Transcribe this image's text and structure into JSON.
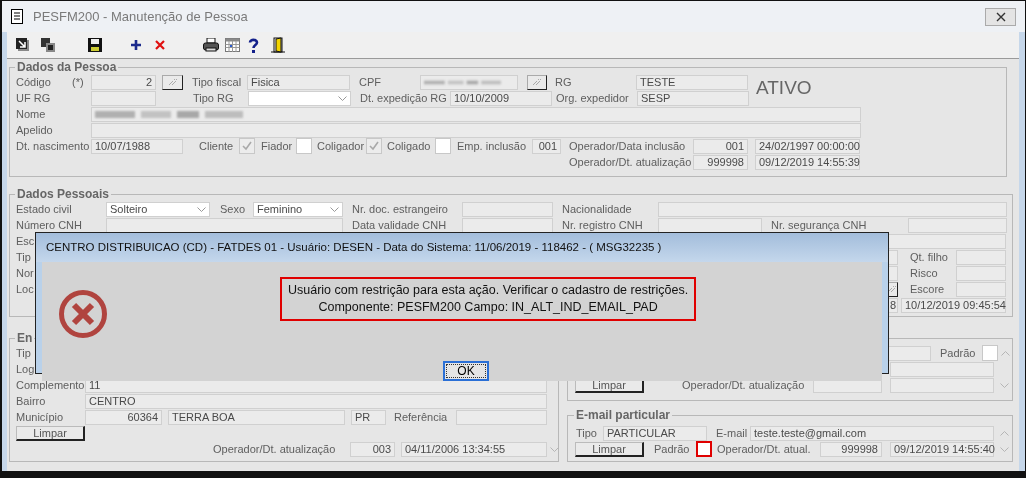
{
  "window": {
    "title": "PESFM200 - Manutenção de Pessoa"
  },
  "dados_pessoa": {
    "title": "Dados da Pessoa",
    "codigo": {
      "label": "Código",
      "required_mark": "(*)",
      "value": "2"
    },
    "tipo_fiscal": {
      "label": "Tipo fiscal",
      "value": "Fisica"
    },
    "cpf": {
      "label": "CPF"
    },
    "rg": {
      "label": "RG",
      "value": "TESTE"
    },
    "status": "ATIVO",
    "uf_rg": {
      "label": "UF RG"
    },
    "tipo_rg": {
      "label": "Tipo RG"
    },
    "dt_expedicao_rg": {
      "label": "Dt. expedição RG",
      "value": "10/10/2009"
    },
    "org_expedidor": {
      "label": "Org. expedidor",
      "value": "SESP"
    },
    "nome": {
      "label": "Nome"
    },
    "apelido": {
      "label": "Apelido"
    },
    "dt_nascimento": {
      "label": "Dt. nascimento",
      "value": "10/07/1988"
    },
    "flags": [
      {
        "label": "Cliente",
        "checked": true
      },
      {
        "label": "Fiador",
        "checked": false
      },
      {
        "label": "Coligador",
        "checked": true
      },
      {
        "label": "Coligado",
        "checked": false
      }
    ],
    "emp_inclusao": {
      "label": "Emp. inclusão",
      "value": "001"
    },
    "inclusao": {
      "label": "Operador/Data inclusão",
      "operator": "001",
      "date": "24/02/1997 00:00:00"
    },
    "atualizacao": {
      "label": "Operador/Dt. atualização",
      "operator": "999998",
      "date": "09/12/2019 14:55:39"
    }
  },
  "dados_pessoais": {
    "title": "Dados Pessoais",
    "estado_civil": {
      "label": "Estado civil",
      "value": "Solteiro"
    },
    "sexo": {
      "label": "Sexo",
      "value": "Feminino"
    },
    "nr_doc_estrangeiro": {
      "label": "Nr. doc. estrangeiro"
    },
    "nacionalidade": {
      "label": "Nacionalidade"
    },
    "numero_cnh": {
      "label": "Número CNH"
    },
    "data_validade_cnh": {
      "label": "Data validade CNH"
    },
    "nr_registro_cnh": {
      "label": "Nr. registro CNH"
    },
    "nr_seguranca_cnh": {
      "label": "Nr. segurança CNH"
    },
    "covered_labels": [
      "Esc",
      "Tip",
      "Nor",
      "Loc"
    ],
    "qt_filho": {
      "label": "Qt. filho"
    },
    "risco": {
      "label": "Risco"
    },
    "escore": {
      "label": "Escore"
    },
    "atualizacao": {
      "operator": "8",
      "date": "10/12/2019 09:45:54"
    }
  },
  "endereco": {
    "title": "En",
    "covered_labels": [
      "Tip",
      "Log"
    ],
    "complemento": {
      "label": "Complemento",
      "value": "11"
    },
    "bairro": {
      "label": "Bairro",
      "value": "CENTRO"
    },
    "municipio": {
      "label": "Município",
      "code": "60364",
      "name": "TERRA BOA",
      "uf": "PR"
    },
    "referencia": {
      "label": "Referência"
    },
    "clear_button": "Limpar",
    "atualizacao": {
      "label": "Operador/Dt. atualização",
      "operator": "003",
      "date": "04/11/2006 13:34:55"
    }
  },
  "contato": {
    "padrao": {
      "label": "Padrão",
      "checked": false
    },
    "clear_button": "Limpar",
    "atualizacao": {
      "label": "Operador/Dt. atualização"
    }
  },
  "email_particular": {
    "title": "E-mail particular",
    "tipo": {
      "label": "Tipo",
      "value": "PARTICULAR"
    },
    "email": {
      "label": "E-mail",
      "value": "teste.teste@gmail.com"
    },
    "clear_button": "Limpar",
    "padrao": {
      "label": "Padrão",
      "checked": false,
      "highlighted": true
    },
    "atualizacao": {
      "label": "Operador/Dt. atual.",
      "operator": "999998",
      "date": "09/12/2019 14:55:40"
    }
  },
  "dialog": {
    "title": "CENTRO DISTRIBUICAO (CD) - FATDES 01 - Usuário: DESEN - Data do Sistema: 11/06/2019 - 118462 - ( MSG32235 )",
    "message": [
      "Usuário com restrição para esta ação. Verificar o cadastro de restrições.",
      "Componente: PESFM200 Campo: IN_ALT_IND_EMAIL_PAD"
    ],
    "buttons": [
      {
        "label": "OK",
        "selected": true
      }
    ]
  }
}
